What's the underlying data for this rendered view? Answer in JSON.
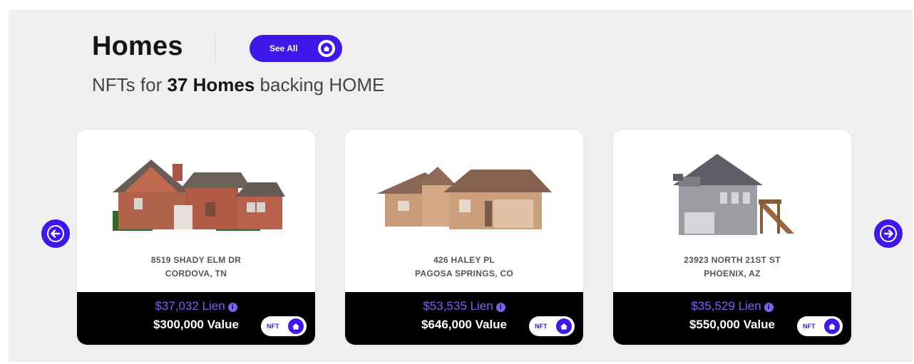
{
  "section": {
    "title": "Homes",
    "see_all_label": "See All",
    "subtitle_prefix": "NFTs for ",
    "subtitle_bold": "37 Homes",
    "subtitle_suffix": " backing HOME"
  },
  "carousel": {
    "prev_icon": "arrow-left-icon",
    "next_icon": "arrow-right-icon"
  },
  "cards": [
    {
      "address_line1": "8519 SHADY ELM DR",
      "address_line2": "CORDOVA, TN",
      "lien": "$37,032 Lien",
      "value": "$300,000 Value",
      "badge": "NFT"
    },
    {
      "address_line1": "426 HALEY PL",
      "address_line2": "PAGOSA SPRINGS, CO",
      "lien": "$53,535 Lien",
      "value": "$646,000 Value",
      "badge": "NFT"
    },
    {
      "address_line1": "23923 NORTH 21ST ST",
      "address_line2": "PHOENIX, AZ",
      "lien": "$35,529 Lien",
      "value": "$550,000 Value",
      "badge": "NFT"
    }
  ],
  "colors": {
    "accent": "#3f17e8",
    "lien_text": "#7c61f0",
    "panel_bg": "#efefef",
    "footer_bg": "#000000"
  }
}
